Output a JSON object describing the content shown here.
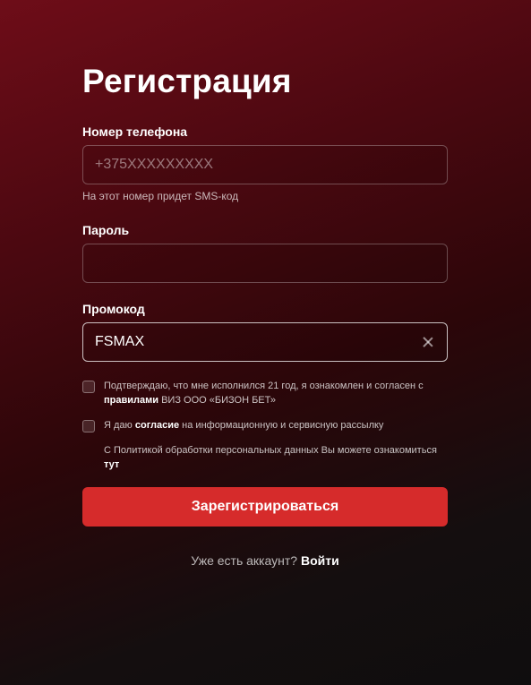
{
  "title": "Регистрация",
  "phone": {
    "label": "Номер телефона",
    "value": "",
    "placeholder": "+375XXXXXXXXX",
    "hint": "На этот номер придет SMS-код"
  },
  "password": {
    "label": "Пароль",
    "value": "",
    "placeholder": ""
  },
  "promo": {
    "label": "Промокод",
    "value": "FSMAX",
    "placeholder": ""
  },
  "agreements": {
    "age_text": "Подтверждаю, что мне исполнился 21 год, я ознакомлен и согласен с",
    "age_link": "правилами",
    "age_suffix": "ВИЗ ООО «БИЗОН БЕТ»",
    "newsletter_prefix": "Я даю",
    "newsletter_link": "согласие",
    "newsletter_suffix": "на информационную и сервисную рассылку",
    "policy_text": "С Политикой обработки персональных данных Вы можете ознакомиться",
    "policy_link": "тут"
  },
  "submit_label": "Зарегистрироваться",
  "login": {
    "question": "Уже есть аккаунт?",
    "link": "Войти"
  },
  "colors": {
    "accent": "#d62b2b",
    "background_top": "#6e0d18",
    "background_bottom": "#0f0d0e"
  }
}
